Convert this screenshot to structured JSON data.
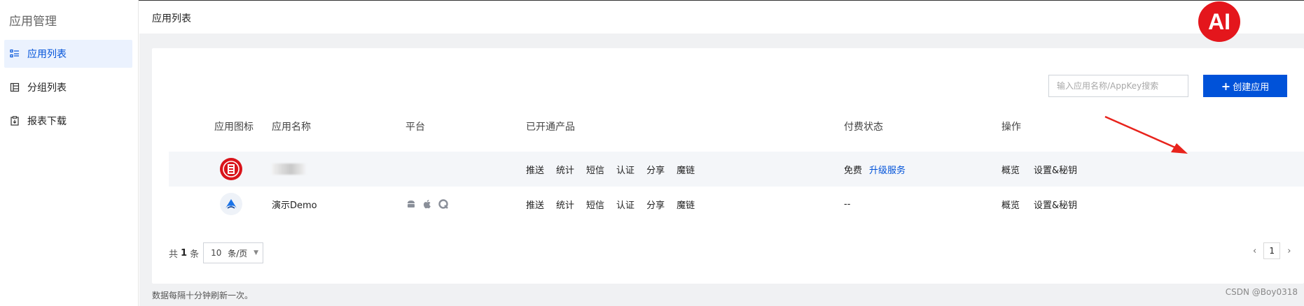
{
  "sidebar": {
    "title": "应用管理",
    "items": [
      {
        "label": "应用列表",
        "icon": "list-icon",
        "active": true
      },
      {
        "label": "分组列表",
        "icon": "group-list-icon",
        "active": false
      },
      {
        "label": "报表下载",
        "icon": "report-download-icon",
        "active": false
      }
    ]
  },
  "header": {
    "title": "应用列表"
  },
  "toolbar": {
    "search_placeholder": "输入应用名称/AppKey搜索",
    "create_label": "创建应用",
    "create_icon": "plus"
  },
  "table": {
    "columns": [
      "应用图标",
      "应用名称",
      "平台",
      "已开通产品",
      "付费状态",
      "操作"
    ],
    "rows": [
      {
        "icon": "red-app-logo",
        "name": "",
        "name_blurred": true,
        "platforms": [],
        "products": [
          "推送",
          "统计",
          "短信",
          "认证",
          "分享",
          "魔链"
        ],
        "pay_status": "免费",
        "pay_action": "升级服务",
        "ops": [
          "概览",
          "设置&秘钥"
        ]
      },
      {
        "icon": "blue-app-logo",
        "name": "演示Demo",
        "name_blurred": false,
        "platforms": [
          "android-icon",
          "apple-icon",
          "quickapp-icon"
        ],
        "products": [
          "推送",
          "统计",
          "短信",
          "认证",
          "分享",
          "魔链"
        ],
        "pay_status": "--",
        "pay_action": "",
        "ops": [
          "概览",
          "设置&秘钥"
        ]
      }
    ]
  },
  "pagination": {
    "total_prefix": "共",
    "total": "1",
    "total_suffix": "条",
    "page_size": "10",
    "page_size_unit": "条/页",
    "current_page": "1"
  },
  "footer": {
    "note": "数据每隔十分钟刷新一次。"
  },
  "watermark": "CSDN @Boy0318",
  "badge": {
    "text": "AI",
    "color": "#e4161c"
  },
  "colors": {
    "primary": "#0052d9",
    "annotation_arrow": "#e8231c"
  }
}
